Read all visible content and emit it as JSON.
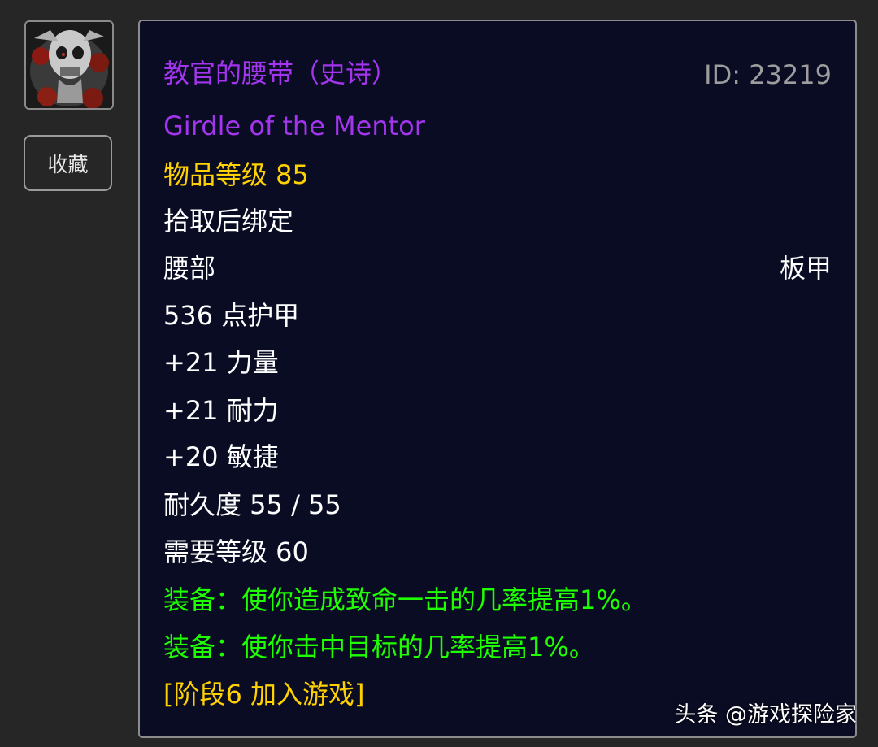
{
  "sidebar": {
    "item_icon": "skull-armor-icon",
    "favorite_label": "收藏"
  },
  "item": {
    "name_cn": "教官的腰带（史诗）",
    "id_label": "ID: 23219",
    "name_en": "Girdle of the Mentor",
    "item_level": "物品等级 85",
    "binding": "拾取后绑定",
    "slot": "腰部",
    "armor_type": "板甲",
    "armor": "536 点护甲",
    "stat_strength": "+21 力量",
    "stat_stamina": "+21 耐力",
    "stat_agility": "+20 敏捷",
    "durability": "耐久度 55 / 55",
    "required_level": "需要等级 60",
    "equip_effects": [
      "装备：使你造成致命一击的几率提高1%。",
      "装备：使你击中目标的几率提高1%。"
    ],
    "phase": "[阶段6 加入游戏]"
  },
  "watermark": "头条 @游戏探险家",
  "colors": {
    "epic": "#a335ee",
    "gold": "#ffd100",
    "green": "#1eff00",
    "grey": "#9d9d9d",
    "tooltip_bg": "#0a0c24",
    "page_bg": "#262626"
  }
}
